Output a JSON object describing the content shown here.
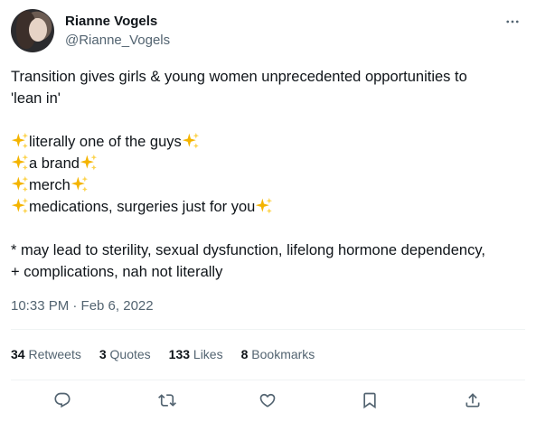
{
  "author": {
    "display_name": "Rianne Vogels",
    "handle": "@Rianne_Vogels"
  },
  "tweet": {
    "line1": "Transition gives girls & young women unprecedented opportunities to",
    "line2": "'lean in'",
    "bullet1": "literally one of the guys",
    "bullet2": "a brand",
    "bullet3": "merch",
    "bullet4": "medications, surgeries just for you",
    "footnote1": "* may lead to sterility, sexual dysfunction, lifelong hormone dependency,",
    "footnote2": "+ complications, nah not literally"
  },
  "timestamp": "10:33 PM · Feb 6, 2022",
  "stats": [
    {
      "count": "34",
      "label": "Retweets"
    },
    {
      "count": "3",
      "label": "Quotes"
    },
    {
      "count": "133",
      "label": "Likes"
    },
    {
      "count": "8",
      "label": "Bookmarks"
    }
  ],
  "icons": {
    "more": "more-dots-icon",
    "sparkles": "sparkles-icon",
    "reply": "reply-icon",
    "retweet": "retweet-icon",
    "like": "heart-icon",
    "bookmark": "bookmark-icon",
    "share": "share-icon"
  },
  "colors": {
    "text": "#0f1419",
    "secondary": "#536471",
    "sparkle": "#f4b400",
    "divider": "#eff3f4"
  }
}
